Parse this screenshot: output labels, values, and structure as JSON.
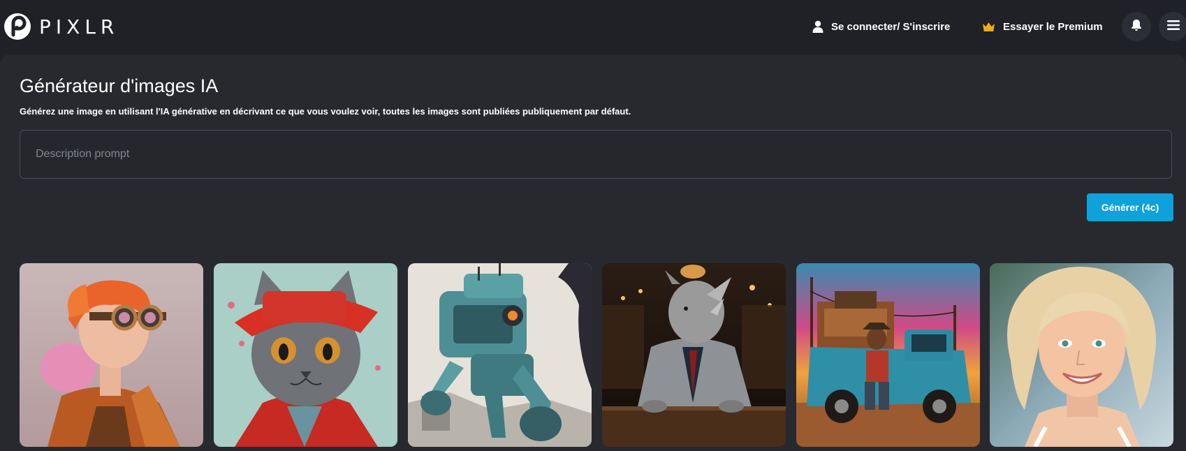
{
  "header": {
    "logo_text": "PIXLR",
    "login_label": "Se connecter/ S'inscrire",
    "premium_label": "Essayer le Premium"
  },
  "main": {
    "title": "Générateur d'images IA",
    "subtitle": "Générez une image en utilisant l'IA générative en décrivant ce que vous voulez voir, toutes les images sont publiées publiquement par défaut.",
    "prompt": {
      "value": "",
      "placeholder": "Description prompt"
    },
    "generate_label": "Générer (4c)"
  },
  "gallery": {
    "items": [
      {
        "subject": "steampunk person with goggles"
      },
      {
        "subject": "grey cat in red hat"
      },
      {
        "subject": "teal robot"
      },
      {
        "subject": "rhino in suit at bar"
      },
      {
        "subject": "man sitting by blue truck at sunset"
      },
      {
        "subject": "smiling blonde woman"
      }
    ]
  },
  "colors": {
    "background": "#1f2126",
    "panel": "#27292e",
    "accent": "#0ea1da",
    "crown": "#f0a81c"
  },
  "icons": {
    "login": "user-icon",
    "premium": "crown-icon",
    "notifications": "bell-icon",
    "menu": "hamburger-icon"
  }
}
